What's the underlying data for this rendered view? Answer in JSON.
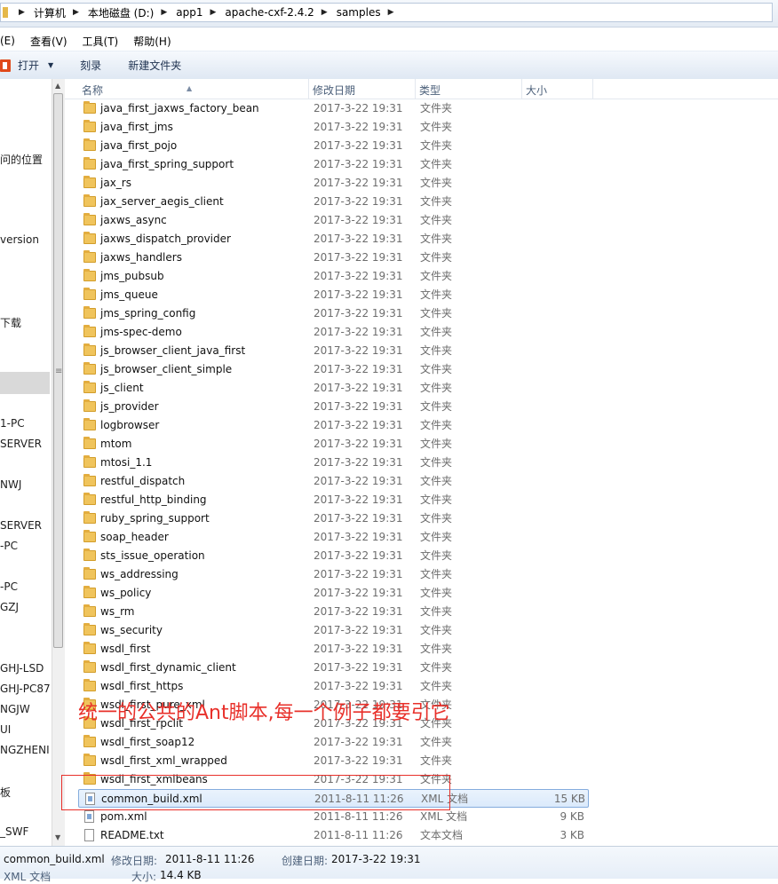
{
  "address": {
    "crumbs": [
      "计算机",
      "本地磁盘 (D:)",
      "app1",
      "apache-cxf-2.4.2",
      "samples"
    ]
  },
  "menu": [
    "(E)",
    "查看(V)",
    "工具(T)",
    "帮助(H)"
  ],
  "toolbar": {
    "open_label": "打开",
    "burn_label": "刻录",
    "new_folder_label": "新建文件夹"
  },
  "nav": {
    "items": [
      "问的位置",
      "version",
      "下载",
      "1-PC",
      "SERVER",
      "NWJ",
      "SERVER",
      "-PC",
      "-PC",
      "GZJ",
      "GHJ-LSD",
      "GHJ-PC87",
      "NGJW",
      "UI",
      "NGZHENI",
      "板",
      "_SWF"
    ]
  },
  "columns": {
    "name": "名称",
    "date": "修改日期",
    "type": "类型",
    "size": "大小"
  },
  "files": [
    {
      "name": "java_first_jaxws_factory_bean",
      "date": "2017-3-22 19:31",
      "type": "文件夹",
      "size": "",
      "kind": "folder"
    },
    {
      "name": "java_first_jms",
      "date": "2017-3-22 19:31",
      "type": "文件夹",
      "size": "",
      "kind": "folder"
    },
    {
      "name": "java_first_pojo",
      "date": "2017-3-22 19:31",
      "type": "文件夹",
      "size": "",
      "kind": "folder"
    },
    {
      "name": "java_first_spring_support",
      "date": "2017-3-22 19:31",
      "type": "文件夹",
      "size": "",
      "kind": "folder"
    },
    {
      "name": "jax_rs",
      "date": "2017-3-22 19:31",
      "type": "文件夹",
      "size": "",
      "kind": "folder"
    },
    {
      "name": "jax_server_aegis_client",
      "date": "2017-3-22 19:31",
      "type": "文件夹",
      "size": "",
      "kind": "folder"
    },
    {
      "name": "jaxws_async",
      "date": "2017-3-22 19:31",
      "type": "文件夹",
      "size": "",
      "kind": "folder"
    },
    {
      "name": "jaxws_dispatch_provider",
      "date": "2017-3-22 19:31",
      "type": "文件夹",
      "size": "",
      "kind": "folder"
    },
    {
      "name": "jaxws_handlers",
      "date": "2017-3-22 19:31",
      "type": "文件夹",
      "size": "",
      "kind": "folder"
    },
    {
      "name": "jms_pubsub",
      "date": "2017-3-22 19:31",
      "type": "文件夹",
      "size": "",
      "kind": "folder"
    },
    {
      "name": "jms_queue",
      "date": "2017-3-22 19:31",
      "type": "文件夹",
      "size": "",
      "kind": "folder"
    },
    {
      "name": "jms_spring_config",
      "date": "2017-3-22 19:31",
      "type": "文件夹",
      "size": "",
      "kind": "folder"
    },
    {
      "name": "jms-spec-demo",
      "date": "2017-3-22 19:31",
      "type": "文件夹",
      "size": "",
      "kind": "folder"
    },
    {
      "name": "js_browser_client_java_first",
      "date": "2017-3-22 19:31",
      "type": "文件夹",
      "size": "",
      "kind": "folder"
    },
    {
      "name": "js_browser_client_simple",
      "date": "2017-3-22 19:31",
      "type": "文件夹",
      "size": "",
      "kind": "folder"
    },
    {
      "name": "js_client",
      "date": "2017-3-22 19:31",
      "type": "文件夹",
      "size": "",
      "kind": "folder"
    },
    {
      "name": "js_provider",
      "date": "2017-3-22 19:31",
      "type": "文件夹",
      "size": "",
      "kind": "folder"
    },
    {
      "name": "logbrowser",
      "date": "2017-3-22 19:31",
      "type": "文件夹",
      "size": "",
      "kind": "folder"
    },
    {
      "name": "mtom",
      "date": "2017-3-22 19:31",
      "type": "文件夹",
      "size": "",
      "kind": "folder"
    },
    {
      "name": "mtosi_1.1",
      "date": "2017-3-22 19:31",
      "type": "文件夹",
      "size": "",
      "kind": "folder"
    },
    {
      "name": "restful_dispatch",
      "date": "2017-3-22 19:31",
      "type": "文件夹",
      "size": "",
      "kind": "folder"
    },
    {
      "name": "restful_http_binding",
      "date": "2017-3-22 19:31",
      "type": "文件夹",
      "size": "",
      "kind": "folder"
    },
    {
      "name": "ruby_spring_support",
      "date": "2017-3-22 19:31",
      "type": "文件夹",
      "size": "",
      "kind": "folder"
    },
    {
      "name": "soap_header",
      "date": "2017-3-22 19:31",
      "type": "文件夹",
      "size": "",
      "kind": "folder"
    },
    {
      "name": "sts_issue_operation",
      "date": "2017-3-22 19:31",
      "type": "文件夹",
      "size": "",
      "kind": "folder"
    },
    {
      "name": "ws_addressing",
      "date": "2017-3-22 19:31",
      "type": "文件夹",
      "size": "",
      "kind": "folder"
    },
    {
      "name": "ws_policy",
      "date": "2017-3-22 19:31",
      "type": "文件夹",
      "size": "",
      "kind": "folder"
    },
    {
      "name": "ws_rm",
      "date": "2017-3-22 19:31",
      "type": "文件夹",
      "size": "",
      "kind": "folder"
    },
    {
      "name": "ws_security",
      "date": "2017-3-22 19:31",
      "type": "文件夹",
      "size": "",
      "kind": "folder"
    },
    {
      "name": "wsdl_first",
      "date": "2017-3-22 19:31",
      "type": "文件夹",
      "size": "",
      "kind": "folder"
    },
    {
      "name": "wsdl_first_dynamic_client",
      "date": "2017-3-22 19:31",
      "type": "文件夹",
      "size": "",
      "kind": "folder"
    },
    {
      "name": "wsdl_first_https",
      "date": "2017-3-22 19:31",
      "type": "文件夹",
      "size": "",
      "kind": "folder"
    },
    {
      "name": "wsdl_first_pure_xml",
      "date": "2017-3-22 19:31",
      "type": "文件夹",
      "size": "",
      "kind": "folder"
    },
    {
      "name": "wsdl_first_rpclit",
      "date": "2017-3-22 19:31",
      "type": "文件夹",
      "size": "",
      "kind": "folder"
    },
    {
      "name": "wsdl_first_soap12",
      "date": "2017-3-22 19:31",
      "type": "文件夹",
      "size": "",
      "kind": "folder"
    },
    {
      "name": "wsdl_first_xml_wrapped",
      "date": "2017-3-22 19:31",
      "type": "文件夹",
      "size": "",
      "kind": "folder"
    },
    {
      "name": "wsdl_first_xmlbeans",
      "date": "2017-3-22 19:31",
      "type": "文件夹",
      "size": "",
      "kind": "folder"
    },
    {
      "name": "common_build.xml",
      "date": "2011-8-11 11:26",
      "type": "XML 文档",
      "size": "15 KB",
      "kind": "xml",
      "selected": true
    },
    {
      "name": "pom.xml",
      "date": "2011-8-11 11:26",
      "type": "XML 文档",
      "size": "9 KB",
      "kind": "xml"
    },
    {
      "name": "README.txt",
      "date": "2011-8-11 11:26",
      "type": "文本文档",
      "size": "3 KB",
      "kind": "txt"
    }
  ],
  "annotation": {
    "text": "统一的公共的Ant脚本,每一个例子都要引它"
  },
  "details": {
    "filename": "common_build.xml",
    "modified_label": "修改日期:",
    "modified_value": "2011-8-11 11:26",
    "created_label": "创建日期:",
    "created_value": "2017-3-22 19:31",
    "type_value": "XML 文档",
    "size_label": "大小:",
    "size_value": "14.4 KB"
  },
  "colors": {
    "annotation": "#e8302a",
    "selection_border": "#84acdd",
    "folder": "#f0c45c"
  }
}
